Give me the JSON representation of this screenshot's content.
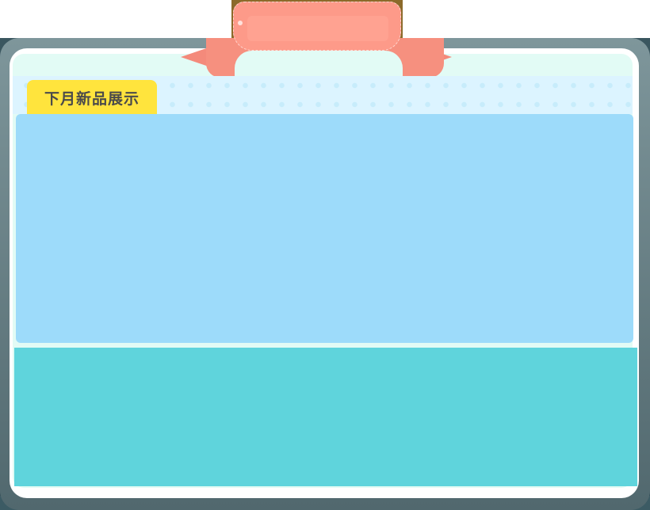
{
  "popup": {
    "tab_label": "下月新品展示"
  },
  "colors": {
    "ribbon": "#fd9a89",
    "tab": "#ffe43d",
    "preview_bg": "#9ddbfa",
    "footer_bg": "#5fd4dc",
    "panel_bg": "#e2fbf5"
  }
}
